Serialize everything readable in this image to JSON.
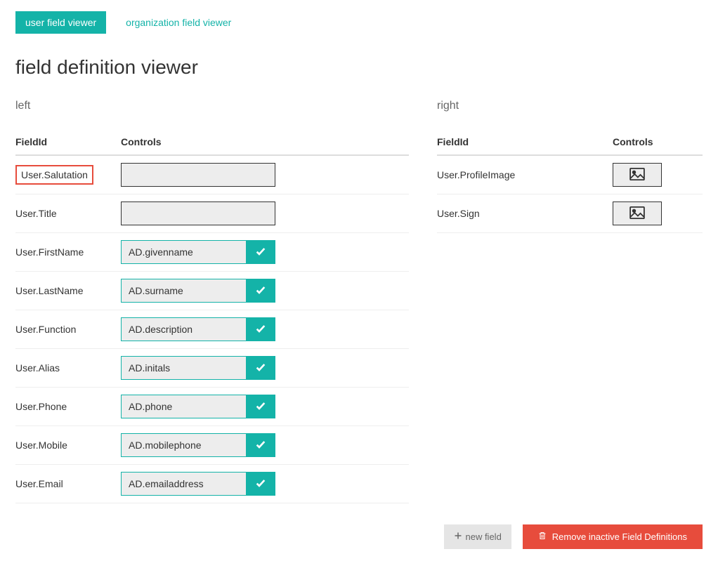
{
  "tabs": {
    "user": "user field viewer",
    "org": "organization field viewer"
  },
  "page_title": "field definition viewer",
  "columns": {
    "left_heading": "left",
    "right_heading": "right",
    "header_fieldid": "FieldId",
    "header_controls": "Controls"
  },
  "left_rows": [
    {
      "fieldId": "User.Salutation",
      "control_type": "text",
      "value": "",
      "highlighted": true
    },
    {
      "fieldId": "User.Title",
      "control_type": "text",
      "value": ""
    },
    {
      "fieldId": "User.FirstName",
      "control_type": "mapped",
      "value": "AD.givenname"
    },
    {
      "fieldId": "User.LastName",
      "control_type": "mapped",
      "value": "AD.surname"
    },
    {
      "fieldId": "User.Function",
      "control_type": "mapped",
      "value": "AD.description"
    },
    {
      "fieldId": "User.Alias",
      "control_type": "mapped",
      "value": "AD.initals"
    },
    {
      "fieldId": "User.Phone",
      "control_type": "mapped",
      "value": "AD.phone"
    },
    {
      "fieldId": "User.Mobile",
      "control_type": "mapped",
      "value": "AD.mobilephone"
    },
    {
      "fieldId": "User.Email",
      "control_type": "mapped",
      "value": "AD.emailaddress"
    }
  ],
  "right_rows": [
    {
      "fieldId": "User.ProfileImage",
      "control_type": "image"
    },
    {
      "fieldId": "User.Sign",
      "control_type": "image"
    }
  ],
  "footer": {
    "new_field": "new field",
    "remove": "Remove inactive Field Definitions"
  }
}
